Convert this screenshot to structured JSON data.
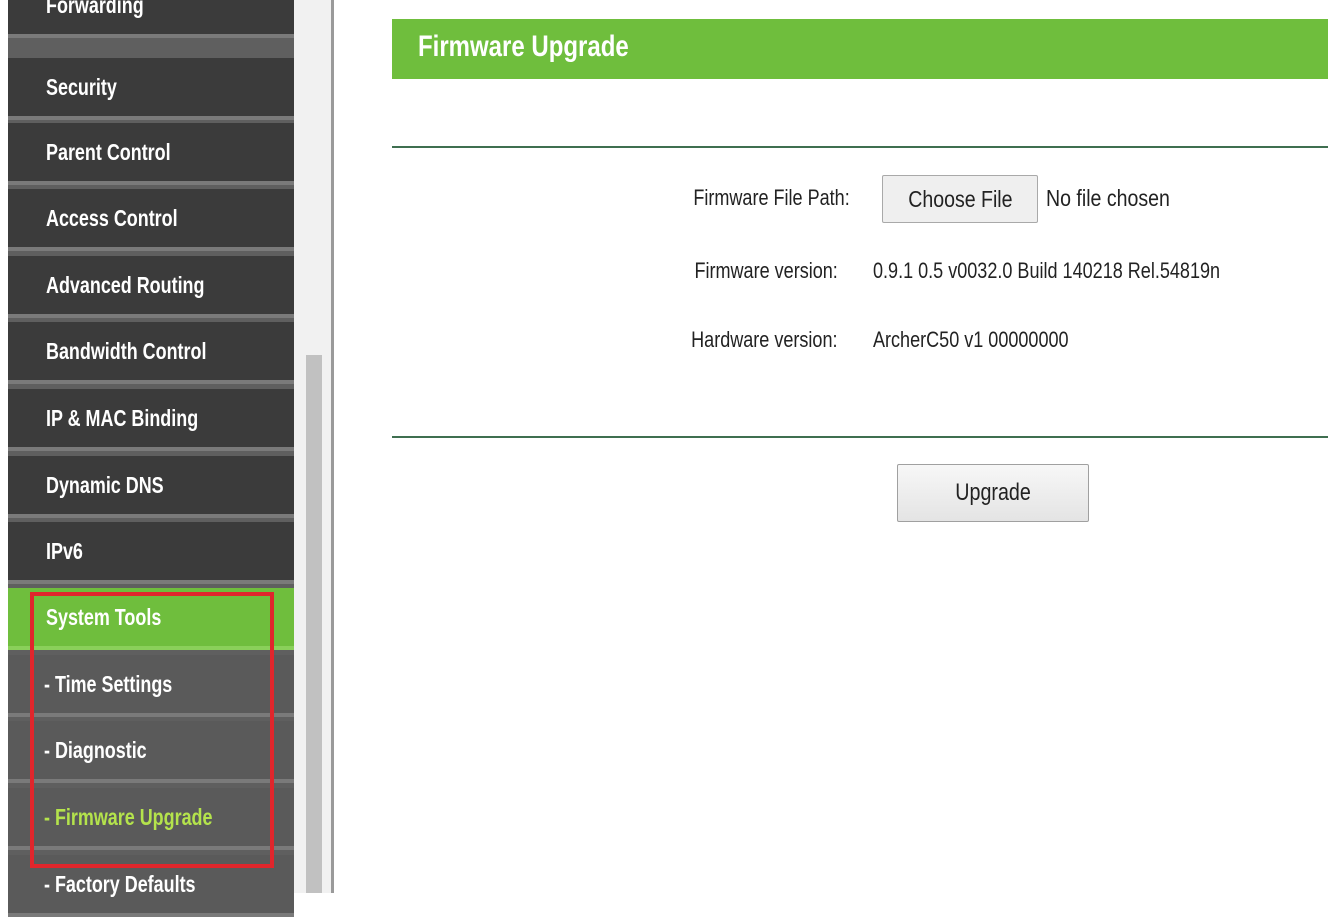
{
  "sidebar": {
    "items": [
      {
        "label": "Forwarding"
      },
      {
        "label": "Security"
      },
      {
        "label": "Parent Control"
      },
      {
        "label": "Access Control"
      },
      {
        "label": "Advanced Routing"
      },
      {
        "label": "Bandwidth Control"
      },
      {
        "label": "IP & MAC Binding"
      },
      {
        "label": "Dynamic DNS"
      },
      {
        "label": "IPv6"
      },
      {
        "label": "System Tools"
      }
    ],
    "subitems": [
      {
        "label": "- Time Settings"
      },
      {
        "label": "- Diagnostic"
      },
      {
        "label": "- Firmware Upgrade"
      },
      {
        "label": "- Factory Defaults"
      }
    ]
  },
  "header": {
    "title": "Firmware Upgrade"
  },
  "form": {
    "file_path_label": "Firmware File Path:",
    "choose_file_label": "Choose File",
    "file_status": "No file chosen",
    "firmware_version_label": "Firmware version:",
    "firmware_version_value": "0.9.1 0.5 v0032.0 Build 140218 Rel.54819n",
    "hardware_version_label": "Hardware version:",
    "hardware_version_value": "ArcherC50 v1 00000000",
    "upgrade_label": "Upgrade"
  },
  "colors": {
    "accent_green": "#6fbe3d",
    "active_subitem_text": "#b4e34c",
    "highlight_red": "#e0262c"
  }
}
